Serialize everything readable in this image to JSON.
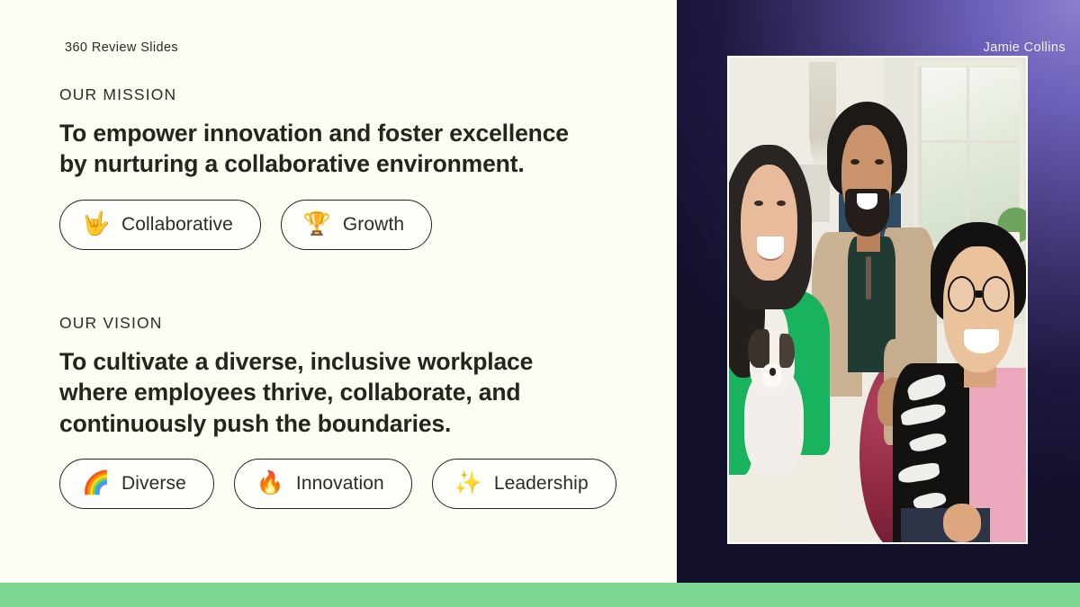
{
  "deck": {
    "label": "360 Review Slides"
  },
  "presenter": {
    "name": "Jamie Collins"
  },
  "sections": [
    {
      "eyebrow": "OUR MISSION",
      "statement_lines": [
        "To empower innovation and foster excellence",
        "by nurturing a collaborative environment."
      ],
      "chips": [
        {
          "emoji": "🤟",
          "icon_name": "love-you-gesture-emoji",
          "label": "Collaborative"
        },
        {
          "emoji": "🏆",
          "icon_name": "trophy-emoji",
          "label": "Growth"
        }
      ]
    },
    {
      "eyebrow": "OUR VISION",
      "statement_lines": [
        "To cultivate a diverse, inclusive workplace",
        "where employees thrive, collaborate, and",
        "continuously push the boundaries."
      ],
      "chips": [
        {
          "emoji": "🌈",
          "icon_name": "rainbow-emoji",
          "label": "Diverse"
        },
        {
          "emoji": "🔥",
          "icon_name": "fire-emoji",
          "label": "Innovation"
        },
        {
          "emoji": "✨",
          "icon_name": "sparkles-emoji",
          "label": "Leadership"
        }
      ]
    }
  ],
  "photo": {
    "alt": "Three smiling colleagues sitting together, woman in green blazer holding a small dog"
  },
  "colors": {
    "background": "#fdfdf3",
    "text": "#23251f",
    "panel_purple_light": "#8b80d0",
    "panel_purple_dark": "#13102c",
    "accent_green": "#7ed693",
    "chip_border": "#23251f"
  }
}
